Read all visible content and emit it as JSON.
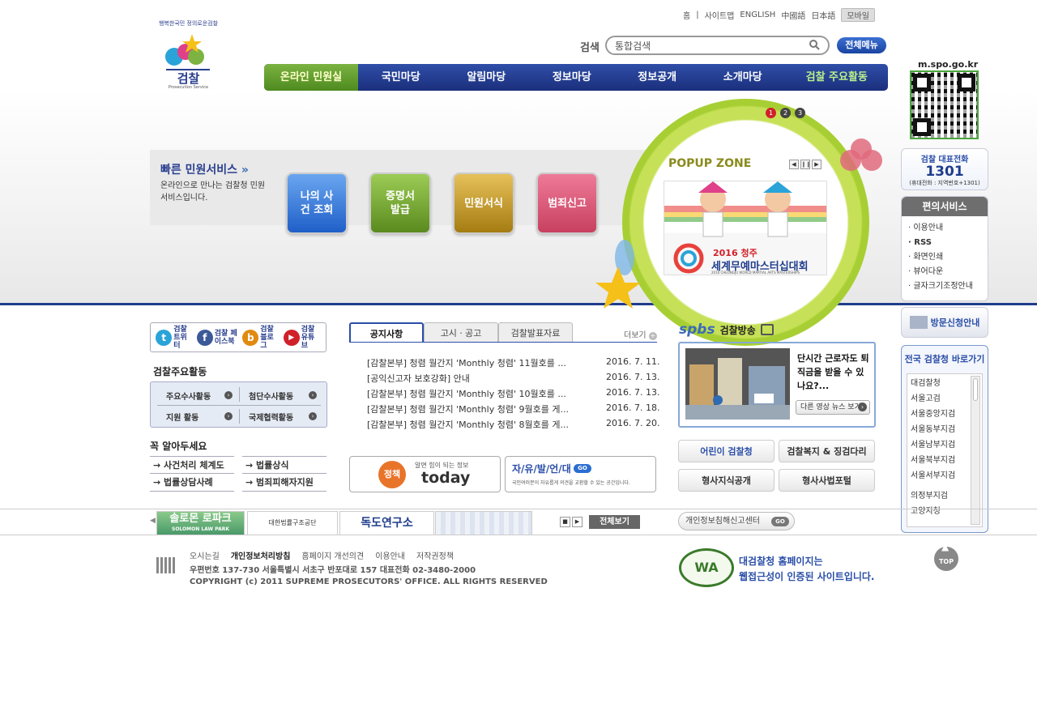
{
  "top_nav": [
    "홈",
    "사이트맵",
    "ENGLISH",
    "中國語",
    "日本語"
  ],
  "mobile_label": "모바일",
  "search": {
    "label": "검색",
    "placeholder": "통합검색"
  },
  "all_menu": "전체메뉴",
  "logo": {
    "name": "검찰",
    "sub": "Prosecution Service",
    "slogan": "행복한국민 정의로운검찰"
  },
  "gnb": [
    "온라인 민원실",
    "국민마당",
    "알림마당",
    "정보마당",
    "정보공개",
    "소개마당",
    "검찰 주요활동"
  ],
  "quick": {
    "title": "빠른 민원서비스",
    "desc": "온라인으로 만나는 검찰청 민원 서비스입니다.",
    "buttons": [
      "나의 사건 조회",
      "증명서 발급",
      "민원서식",
      "범죄신고"
    ]
  },
  "popup": {
    "title": "POPUP ZONE",
    "pages": [
      "1",
      "2",
      "3"
    ],
    "banner_year": "2016 청주",
    "banner_title": "세계무예마스터십대회",
    "banner_en": "2016 CHEONGJU WORLD MARTIAL ARTS MASTERSHIPS"
  },
  "qr_label": "m.spo.go.kr",
  "phone": {
    "title": "검찰 대표전화",
    "number": "1301",
    "note": "(휴대전화 : 지역번호+1301)"
  },
  "convenience": {
    "title": "편의서비스",
    "items": [
      "이용안내",
      "RSS",
      "화면인쇄",
      "뷰어다운",
      "글자크기조정안내"
    ]
  },
  "visit": "방문신청안내",
  "sns": [
    {
      "ic": "t",
      "label": "검찰 트위터",
      "color": "#2aa3d8"
    },
    {
      "ic": "f",
      "label": "검찰 페이스북",
      "color": "#3b5998"
    },
    {
      "ic": "b",
      "label": "검찰 블로그",
      "color": "#e08a10"
    },
    {
      "ic": "▶",
      "label": "검찰 유튜브",
      "color": "#d0212a"
    }
  ],
  "activity": {
    "title": "검찰주요활동",
    "items": [
      "주요수사활동",
      "첨단수사활동",
      "지원 활동",
      "국제협력활동"
    ]
  },
  "must_know": {
    "title": "꼭 알아두세요",
    "items": [
      "사건처리 체계도",
      "법률상식",
      "법률상담사례",
      "범죄피해자지원"
    ]
  },
  "notice_tabs": [
    "공지사항",
    "고시ㆍ공고",
    "검찰발표자료"
  ],
  "more": "더보기",
  "notices": [
    {
      "title": "[감찰본부] 청렴 월간지 'Monthly 청렴' 11월호를 ...",
      "date": "2016. 7. 11."
    },
    {
      "title": "[공익신고자 보호강화] 안내",
      "date": "2016. 7. 13."
    },
    {
      "title": "[감찰본부] 청렴 월간지 'Monthly 청렴' 10월호를 ...",
      "date": "2016. 7. 13."
    },
    {
      "title": "[감찰본부] 청렴 월간지 'Monthly 청렴' 9월호를 게...",
      "date": "2016. 7. 18."
    },
    {
      "title": "[감찰본부] 청렴 월간지 'Monthly 청렴' 8월호를 게...",
      "date": "2016. 7. 20."
    }
  ],
  "banner_policy": {
    "tag": "알면 힘이 되는 정보",
    "logo": "정책",
    "word": "today"
  },
  "banner_free": {
    "title": "자/유/발/언/대",
    "go": "GO",
    "desc": "국민여러분이 자유롭게 의견을 교환할 수 있는 공간입니다."
  },
  "spbs": {
    "logo": "spbs",
    "title": "검찰방송"
  },
  "video": {
    "caption": "단시간 근로자도 퇴직금을 받을 수 있나요?...",
    "more": "다른 영상 뉴스 보기"
  },
  "right_buttons": [
    "어린이 검찰청",
    "검찰복지 & 징검다리",
    "형사지식공개",
    "형사사법포털"
  ],
  "courts": {
    "title": "전국 검찰청 바로가기",
    "items": [
      "대검찰청",
      "서울고검",
      "서울중앙지검",
      "서울동부지검",
      "서울남부지검",
      "서울북부지검",
      "서울서부지검",
      "의정부지검",
      "고양지청"
    ]
  },
  "family": {
    "items": [
      "솔로몬 로파크",
      "대한법률구조공단",
      "독도연구소"
    ],
    "solomon_en": "SOLOMON LAW PARK",
    "view_all": "전체보기",
    "privacy": "개인정보침해신고센터",
    "go": "GO"
  },
  "footer": {
    "links": [
      "오시는길",
      "개인정보처리방침",
      "홈페이지 개선의견",
      "이용안내",
      "저작권정책"
    ],
    "addr": "우편번호 137-730 서울특별시 서초구 반포대로 157 대표전화 02-3480-2000",
    "copy": "COPYRIGHT (c) 2011 SUPREME PROSECUTORS' OFFICE. ALL RIGHTS RESERVED",
    "wa_mark": "WA",
    "wa_line1": "대검찰청 홈페이지는",
    "wa_line2": "웹접근성이 인증된 사이트입니다.",
    "top": "TOP"
  },
  "colors": {
    "navy": "#1f3d8c",
    "green": "#7cb342",
    "red": "#d0212a"
  }
}
